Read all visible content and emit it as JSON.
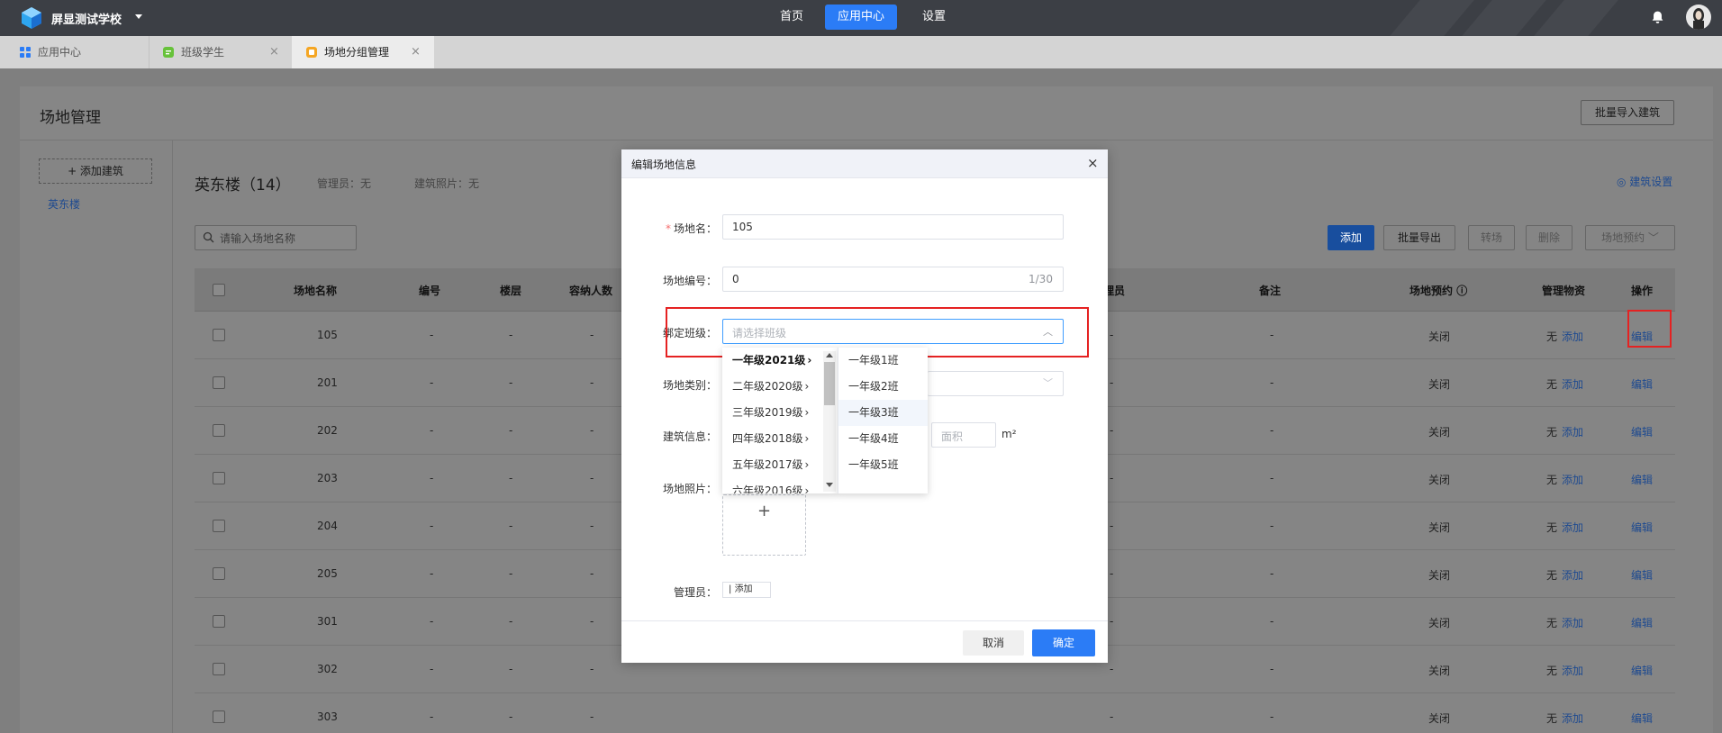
{
  "topbar": {
    "school": "屏显测试学校",
    "nav": [
      {
        "label": "首页"
      },
      {
        "label": "应用中心"
      },
      {
        "label": "设置"
      }
    ]
  },
  "tabs": [
    {
      "label": "应用中心"
    },
    {
      "label": "班级学生",
      "close": "×"
    },
    {
      "label": "场地分组管理",
      "close": "×"
    }
  ],
  "page": {
    "title": "场地管理",
    "import_btn": "批量导入建筑",
    "add_building": "+ 添加建筑",
    "side_items": [
      "英东楼"
    ],
    "building_title": "英东楼（14）",
    "manager_meta": "管理员：无",
    "photo_meta": "建筑照片：无",
    "settings_link": "建筑设置",
    "search_placeholder": "请输入场地名称",
    "actions": {
      "add": "添加",
      "export": "批量导出",
      "transfer": "转场",
      "delete": "删除",
      "reserve": "场地预约"
    },
    "columns": [
      "场地名称",
      "编号",
      "楼层",
      "容纳人数",
      "理员",
      "备注",
      "场地预约",
      "管理物资",
      "操作"
    ],
    "rows": [
      {
        "name": "105",
        "num": "-",
        "floor": "-",
        "cap": "-",
        "mgr": "-",
        "note": "-",
        "reserve": "关闭",
        "goods": "无",
        "goods_add": "添加",
        "op": "编辑"
      },
      {
        "name": "201",
        "num": "-",
        "floor": "-",
        "cap": "-",
        "mgr": "-",
        "note": "-",
        "reserve": "关闭",
        "goods": "无",
        "goods_add": "添加",
        "op": "编辑"
      },
      {
        "name": "202",
        "num": "-",
        "floor": "-",
        "cap": "-",
        "mgr": "-",
        "note": "-",
        "reserve": "关闭",
        "goods": "无",
        "goods_add": "添加",
        "op": "编辑"
      },
      {
        "name": "203",
        "num": "-",
        "floor": "-",
        "cap": "-",
        "mgr": "-",
        "note": "-",
        "reserve": "关闭",
        "goods": "无",
        "goods_add": "添加",
        "op": "编辑"
      },
      {
        "name": "204",
        "num": "-",
        "floor": "-",
        "cap": "-",
        "mgr": "-",
        "note": "-",
        "reserve": "关闭",
        "goods": "无",
        "goods_add": "添加",
        "op": "编辑"
      },
      {
        "name": "205",
        "num": "-",
        "floor": "-",
        "cap": "-",
        "mgr": "-",
        "note": "-",
        "reserve": "关闭",
        "goods": "无",
        "goods_add": "添加",
        "op": "编辑"
      },
      {
        "name": "301",
        "num": "-",
        "floor": "-",
        "cap": "-",
        "mgr": "-",
        "note": "-",
        "reserve": "关闭",
        "goods": "无",
        "goods_add": "添加",
        "op": "编辑"
      },
      {
        "name": "302",
        "num": "-",
        "floor": "-",
        "cap": "-",
        "mgr": "-",
        "note": "-",
        "reserve": "关闭",
        "goods": "无",
        "goods_add": "添加",
        "op": "编辑"
      },
      {
        "name": "303",
        "num": "-",
        "floor": "-",
        "cap": "-",
        "mgr": "-",
        "note": "-",
        "reserve": "关闭",
        "goods": "无",
        "goods_add": "添加",
        "op": "编辑"
      }
    ]
  },
  "modal": {
    "title": "编辑场地信息",
    "close": "×",
    "fields": {
      "name_label": "场地名：",
      "name_value": "105",
      "number_label": "场地编号：",
      "number_value": "0",
      "number_counter": "1/30",
      "class_label": "绑定班级：",
      "class_placeholder": "请选择班级",
      "type_label": "场地类别：",
      "building_label": "建筑信息：",
      "area_placeholder": "面积",
      "area_unit": "m²",
      "photo_label": "场地照片：",
      "upload_plus": "+",
      "manager_label": "管理员：",
      "manager_add": "添加"
    },
    "cancel": "取消",
    "ok": "确定"
  },
  "cascader": {
    "grades": [
      "一年级2021级",
      "二年级2020级",
      "三年级2019级",
      "四年级2018级",
      "五年级2017级",
      "六年级2016级"
    ],
    "classes": [
      "一年级1班",
      "一年级2班",
      "一年级3班",
      "一年级4班",
      "一年级5班"
    ]
  },
  "colors": {
    "primary": "#2b7cf6",
    "highlight": "#e52222"
  }
}
